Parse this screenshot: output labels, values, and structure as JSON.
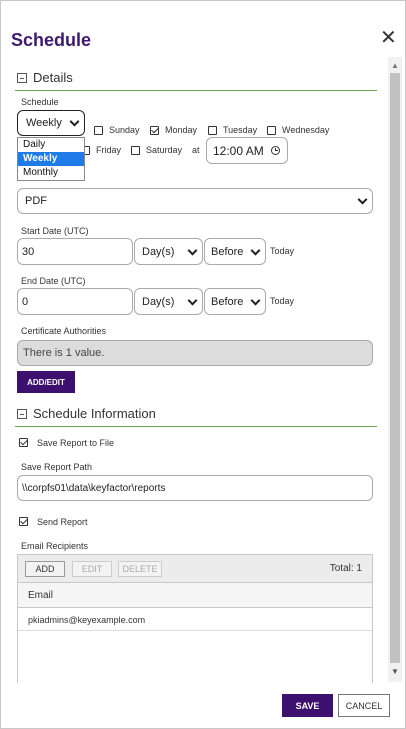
{
  "dialog": {
    "title": "Schedule"
  },
  "details": {
    "header": "Details",
    "schedule_label": "Schedule",
    "schedule_value": "Weekly",
    "schedule_options": [
      "Daily",
      "Weekly",
      "Monthly"
    ],
    "days": [
      {
        "label": "Sunday",
        "checked": false
      },
      {
        "label": "Monday",
        "checked": true
      },
      {
        "label": "Tuesday",
        "checked": false
      },
      {
        "label": "Wednesday",
        "checked": false
      },
      {
        "label": "Friday",
        "checked": false
      },
      {
        "label": "Saturday",
        "checked": false
      }
    ],
    "at_label": "at",
    "time_value": "12:00 AM",
    "format_value": "PDF",
    "start_label": "Start Date (UTC)",
    "start_value": "30",
    "start_unit": "Day(s)",
    "start_relation": "Before",
    "start_today": "Today",
    "end_label": "End Date (UTC)",
    "end_value": "0",
    "end_unit": "Day(s)",
    "end_relation": "Before",
    "end_today": "Today",
    "ca_label": "Certificate Authorities",
    "ca_value": "There is 1 value.",
    "add_edit_label": "ADD/EDIT"
  },
  "schedule_info": {
    "header": "Schedule Information",
    "save_to_file_label": "Save Report to File",
    "save_to_file_checked": true,
    "path_label": "Save Report Path",
    "path_value": "\\\\corpfs01\\data\\keyfactor\\reports",
    "send_report_label": "Send Report",
    "send_report_checked": true,
    "recipients_label": "Email Recipients",
    "grid": {
      "add": "ADD",
      "edit": "EDIT",
      "delete": "DELETE",
      "total": "Total: 1",
      "column": "Email",
      "rows": [
        "pkiadmins@keyexample.com"
      ]
    }
  },
  "footer": {
    "save": "SAVE",
    "cancel": "CANCEL"
  },
  "colors": {
    "accent": "#3d0f6e",
    "section_line": "#6aa84f",
    "selected": "#1e7be8"
  },
  "icons": {
    "close": "close-icon",
    "clock": "clock-icon",
    "collapse": "collapse-icon",
    "chevron": "chevron-down-icon"
  }
}
